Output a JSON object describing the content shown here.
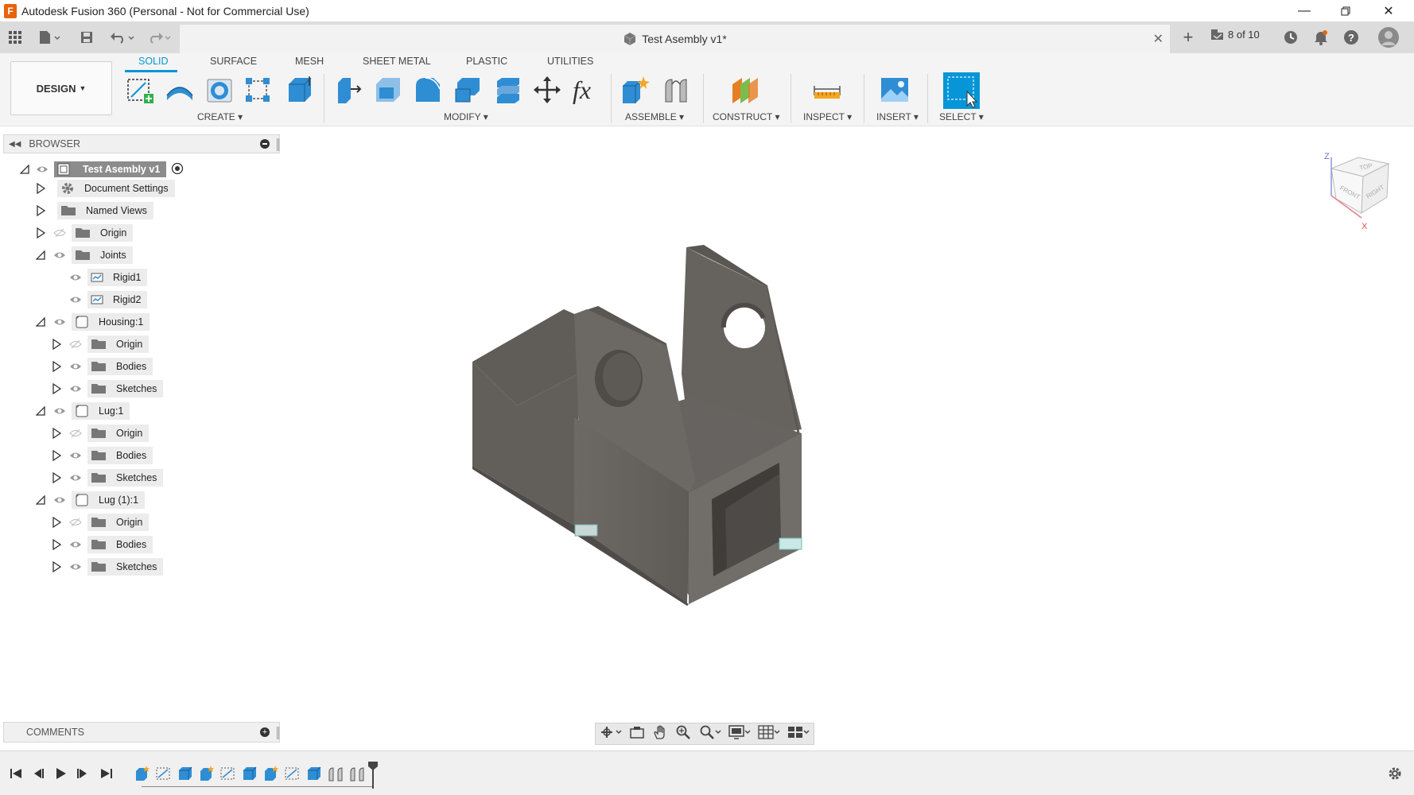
{
  "window": {
    "title": "Autodesk Fusion 360 (Personal - Not for Commercial Use)",
    "app_icon_letter": "F"
  },
  "quick_access": {
    "document_tab_title": "Test Asembly v1*",
    "job_status": "8 of 10"
  },
  "ribbon": {
    "workspace_label": "DESIGN",
    "tabs": [
      "SOLID",
      "SURFACE",
      "MESH",
      "SHEET METAL",
      "PLASTIC",
      "UTILITIES"
    ],
    "active_tab": "SOLID",
    "groups": {
      "create": "CREATE",
      "modify": "MODIFY",
      "assemble": "ASSEMBLE",
      "construct": "CONSTRUCT",
      "inspect": "INSPECT",
      "insert": "INSERT",
      "select": "SELECT"
    }
  },
  "browser": {
    "header": "BROWSER",
    "root": "Test Asembly v1",
    "items": [
      {
        "label": "Document Settings",
        "icon": "gear-icon"
      },
      {
        "label": "Named Views",
        "icon": "folder-icon"
      },
      {
        "label": "Origin",
        "icon": "folder-icon"
      },
      {
        "label": "Joints",
        "icon": "folder-icon"
      },
      {
        "label": "Rigid1",
        "icon": "joint-icon"
      },
      {
        "label": "Rigid2",
        "icon": "joint-icon"
      },
      {
        "label": "Housing:1",
        "icon": "component-icon"
      },
      {
        "label": "Origin",
        "icon": "folder-icon"
      },
      {
        "label": "Bodies",
        "icon": "folder-icon"
      },
      {
        "label": "Sketches",
        "icon": "folder-icon"
      },
      {
        "label": "Lug:1",
        "icon": "component-icon"
      },
      {
        "label": "Origin",
        "icon": "folder-icon"
      },
      {
        "label": "Bodies",
        "icon": "folder-icon"
      },
      {
        "label": "Sketches",
        "icon": "folder-icon"
      },
      {
        "label": "Lug (1):1",
        "icon": "component-icon"
      },
      {
        "label": "Origin",
        "icon": "folder-icon"
      },
      {
        "label": "Bodies",
        "icon": "folder-icon"
      },
      {
        "label": "Sketches",
        "icon": "folder-icon"
      }
    ]
  },
  "viewcube": {
    "top": "TOP",
    "front": "FRONT",
    "right": "RIGHT",
    "axis_z": "Z",
    "axis_x": "X"
  },
  "comments": {
    "header": "COMMENTS"
  },
  "colors": {
    "accent": "#0696d7",
    "model": "#6e6a66",
    "ribbon_bg": "#f4f4f4"
  }
}
